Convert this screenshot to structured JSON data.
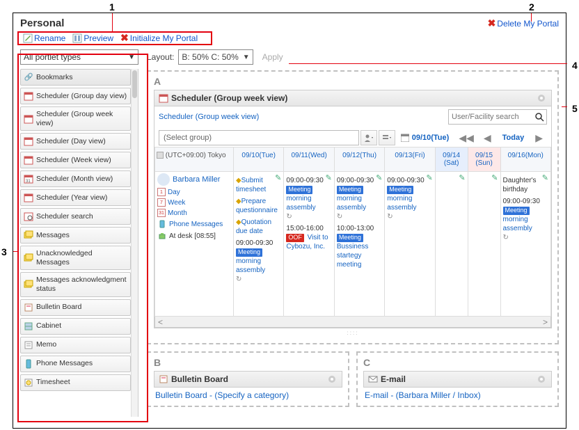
{
  "page_title": "Personal",
  "delete_link": "Delete My Portal",
  "actions": {
    "rename": "Rename",
    "preview": "Preview",
    "initialize": "Initialize My Portal"
  },
  "portlet_filter": "All portlet types",
  "portlets": {
    "bookmarks": "Bookmarks",
    "sched_group_day": "Scheduler (Group day view)",
    "sched_group_week": "Scheduler (Group week view)",
    "sched_day": "Scheduler (Day view)",
    "sched_week": "Scheduler (Week view)",
    "sched_month": "Scheduler (Month view)",
    "sched_year": "Scheduler (Year view)",
    "sched_search": "Scheduler search",
    "messages": "Messages",
    "unack": "Unacknowledged Messages",
    "ack": "Messages acknowledgment status",
    "bulletin": "Bulletin Board",
    "cabinet": "Cabinet",
    "memo": "Memo",
    "phone": "Phone Messages",
    "timesheet": "Timesheet"
  },
  "layout": {
    "label": "Layout:",
    "value": "B: 50%  C: 50%",
    "apply": "Apply"
  },
  "zoneA": {
    "label": "A",
    "portlet_title": "Scheduler (Group week view)",
    "sub_link": "Scheduler (Group week view)",
    "search_placeholder": "User/Facility search",
    "group_sel": "(Select group)",
    "date_current": "09/10(Tue)",
    "today": "Today",
    "tz": "(UTC+09:00) Tokyo",
    "days": [
      "09/10(Tue)",
      "09/11(Wed)",
      "09/12(Thu)",
      "09/13(Fri)",
      "09/14 (Sat)",
      "09/15 (Sun)",
      "09/16(Mon)"
    ],
    "person": "Barbara Miller",
    "views": {
      "day": "Day",
      "week": "Week",
      "month": "Month",
      "phone": "Phone Messages",
      "atdesk": "At desk",
      "atdesk_time": "[08:55]"
    },
    "events": {
      "tue": {
        "e1": "Submit timesheet",
        "e2": "Prepare questionnaire",
        "e3": "Quotation due date",
        "e4_time": "09:00-09:30",
        "e4_tag": "Meeting",
        "e4_name": "morning assembly"
      },
      "wed": {
        "t1": "09:00-09:30",
        "tag1": "Meeting",
        "n1": "morning assembly",
        "t2": "15:00-16:00",
        "tag2": "OOF",
        "n2": "Visit to Cybozu, Inc."
      },
      "thu": {
        "t1": "09:00-09:30",
        "tag1": "Meeting",
        "n1": "morning assembly",
        "t2": "10:00-13:00",
        "tag2": "Meeting",
        "n2": "Bussiness startegy meeting"
      },
      "fri": {
        "t1": "09:00-09:30",
        "tag1": "Meeting",
        "n1": "morning assembly"
      },
      "mon": {
        "d": "Daughter's birthday",
        "t1": "09:00-09:30",
        "tag1": "Meeting",
        "n1": "morning assembly"
      }
    }
  },
  "zoneB": {
    "label": "B",
    "title": "Bulletin Board",
    "link": "Bulletin Board - (Specify a category)"
  },
  "zoneC": {
    "label": "C",
    "title": "E-mail",
    "link": "E-mail - (Barbara Miller / Inbox)"
  },
  "annotations": {
    "n1": "1",
    "n2": "2",
    "n3": "3",
    "n4": "4",
    "n5": "5"
  }
}
